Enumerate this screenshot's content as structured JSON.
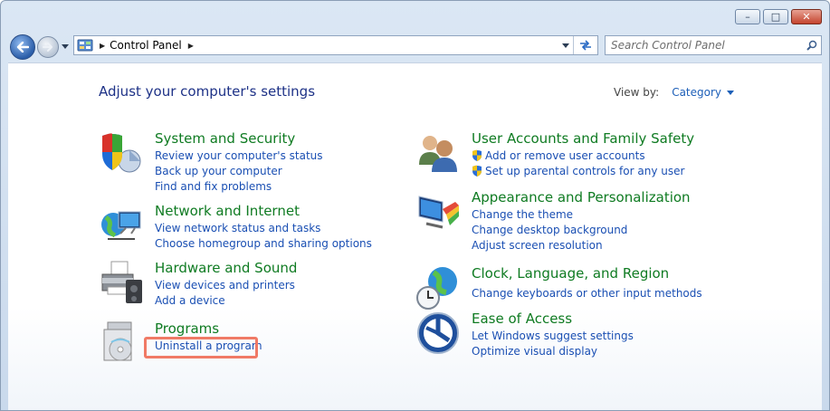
{
  "window": {
    "minimize": "–",
    "maximize": "□",
    "close": "✕"
  },
  "address": {
    "path": "Control Panel"
  },
  "search": {
    "placeholder": "Search Control Panel"
  },
  "page": {
    "title": "Adjust your computer's settings",
    "view_by_label": "View by:",
    "view_by_value": "Category"
  },
  "categories": [
    {
      "title": "System and Security",
      "icon": "shield-icon",
      "links": [
        "Review your computer's status",
        "Back up your computer",
        "Find and fix problems"
      ]
    },
    {
      "title": "Network and Internet",
      "icon": "network-icon",
      "links": [
        "View network status and tasks",
        "Choose homegroup and sharing options"
      ]
    },
    {
      "title": "Hardware and Sound",
      "icon": "printer-icon",
      "links": [
        "View devices and printers",
        "Add a device"
      ]
    },
    {
      "title": "Programs",
      "icon": "programs-icon",
      "links": [
        "Uninstall a program"
      ]
    },
    {
      "title": "User Accounts and Family Safety",
      "icon": "users-icon",
      "links": [
        "Add or remove user accounts",
        "Set up parental controls for any user"
      ]
    },
    {
      "title": "Appearance and Personalization",
      "icon": "appearance-icon",
      "links": [
        "Change the theme",
        "Change desktop background",
        "Adjust screen resolution"
      ]
    },
    {
      "title": "Clock, Language, and Region",
      "icon": "clock-globe-icon",
      "links": [
        "Change keyboards or other input methods"
      ]
    },
    {
      "title": "Ease of Access",
      "icon": "ease-of-access-icon",
      "links": [
        "Let Windows suggest settings",
        "Optimize visual display"
      ]
    }
  ],
  "colors": {
    "title_green": "#0f7b22",
    "link_blue": "#1a4fb3",
    "highlight": "#f07a66"
  }
}
